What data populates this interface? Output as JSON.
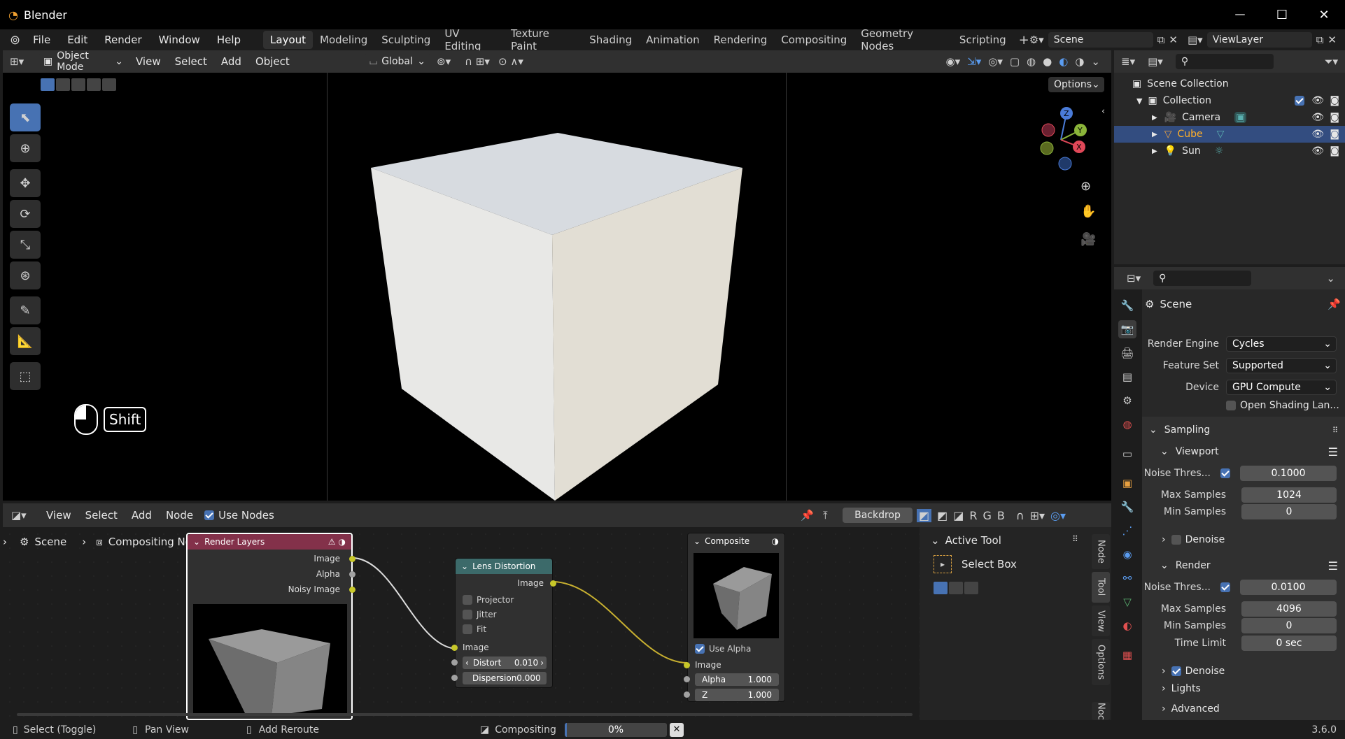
{
  "app": {
    "title": "Blender",
    "version": "3.6.0"
  },
  "window_controls": {
    "minimize": "—",
    "maximize": "☐",
    "close": "✕"
  },
  "menu": [
    "File",
    "Edit",
    "Render",
    "Window",
    "Help"
  ],
  "workspaces": [
    "Layout",
    "Modeling",
    "Sculpting",
    "UV Editing",
    "Texture Paint",
    "Shading",
    "Animation",
    "Rendering",
    "Compositing",
    "Geometry Nodes",
    "Scripting"
  ],
  "active_workspace": "Layout",
  "scene_field": "Scene",
  "viewlayer_field": "ViewLayer",
  "viewport_header": {
    "mode": "Object Mode",
    "menus": [
      "View",
      "Select",
      "Add",
      "Object"
    ],
    "orientation": "Global",
    "options": "Options"
  },
  "keyhint": {
    "key": "Shift"
  },
  "node_editor": {
    "menus": [
      "View",
      "Select",
      "Add",
      "Node"
    ],
    "use_nodes_label": "Use Nodes",
    "backdrop": "Backdrop",
    "channels": [
      "R",
      "G",
      "B"
    ],
    "breadcrumb": {
      "scene": "Scene",
      "tree": "Compositing Nodetree"
    },
    "nodes": {
      "render_layers": {
        "title": "Render Layers",
        "outputs": [
          "Image",
          "Alpha",
          "Noisy Image"
        ]
      },
      "lens_distortion": {
        "title": "Lens Distortion",
        "output": "Image",
        "options": [
          "Projector",
          "Jitter",
          "Fit"
        ],
        "input": "Image",
        "distort_label": "Distort",
        "distort_value": "0.010",
        "dispersion_label": "Dispersion",
        "dispersion_value": "0.000"
      },
      "composite": {
        "title": "Composite",
        "use_alpha": "Use Alpha",
        "input": "Image",
        "alpha_label": "Alpha",
        "alpha_value": "1.000",
        "z_label": "Z",
        "z_value": "1.000"
      }
    },
    "sidebar": {
      "active_tool_title": "Active Tool",
      "tool_name": "Select Box",
      "tabs": [
        "Node",
        "Tool",
        "View",
        "Options",
        "Noc"
      ]
    }
  },
  "outliner": {
    "scene_collection": "Scene Collection",
    "collection": "Collection",
    "items": [
      {
        "name": "Camera",
        "selected": false
      },
      {
        "name": "Cube",
        "selected": true
      },
      {
        "name": "Sun",
        "selected": false
      }
    ]
  },
  "properties": {
    "context": "Scene",
    "render_engine_label": "Render Engine",
    "render_engine": "Cycles",
    "feature_set_label": "Feature Set",
    "feature_set": "Supported",
    "device_label": "Device",
    "device": "GPU Compute",
    "osl_label": "Open Shading Lan...",
    "sampling": "Sampling",
    "viewport": "Viewport",
    "vp_noise_label": "Noise Thres...",
    "vp_noise": "0.1000",
    "vp_max_label": "Max Samples",
    "vp_max": "1024",
    "vp_min_label": "Min Samples",
    "vp_min": "0",
    "vp_denoise": "Denoise",
    "render": "Render",
    "r_noise_label": "Noise Thres...",
    "r_noise": "0.0100",
    "r_max_label": "Max Samples",
    "r_max": "4096",
    "r_min_label": "Min Samples",
    "r_min": "0",
    "r_time_label": "Time Limit",
    "r_time": "0 sec",
    "r_denoise": "Denoise",
    "lights": "Lights",
    "advanced": "Advanced"
  },
  "status": {
    "select": "Select (Toggle)",
    "pan": "Pan View",
    "reroute": "Add Reroute",
    "job": "Compositing",
    "progress_text": "0%",
    "progress": 0
  },
  "colors": {
    "accent": "#4772b3",
    "render_layers_header": "#83314a",
    "lens_header": "#3c6a6a",
    "composite_header": "#303030"
  }
}
